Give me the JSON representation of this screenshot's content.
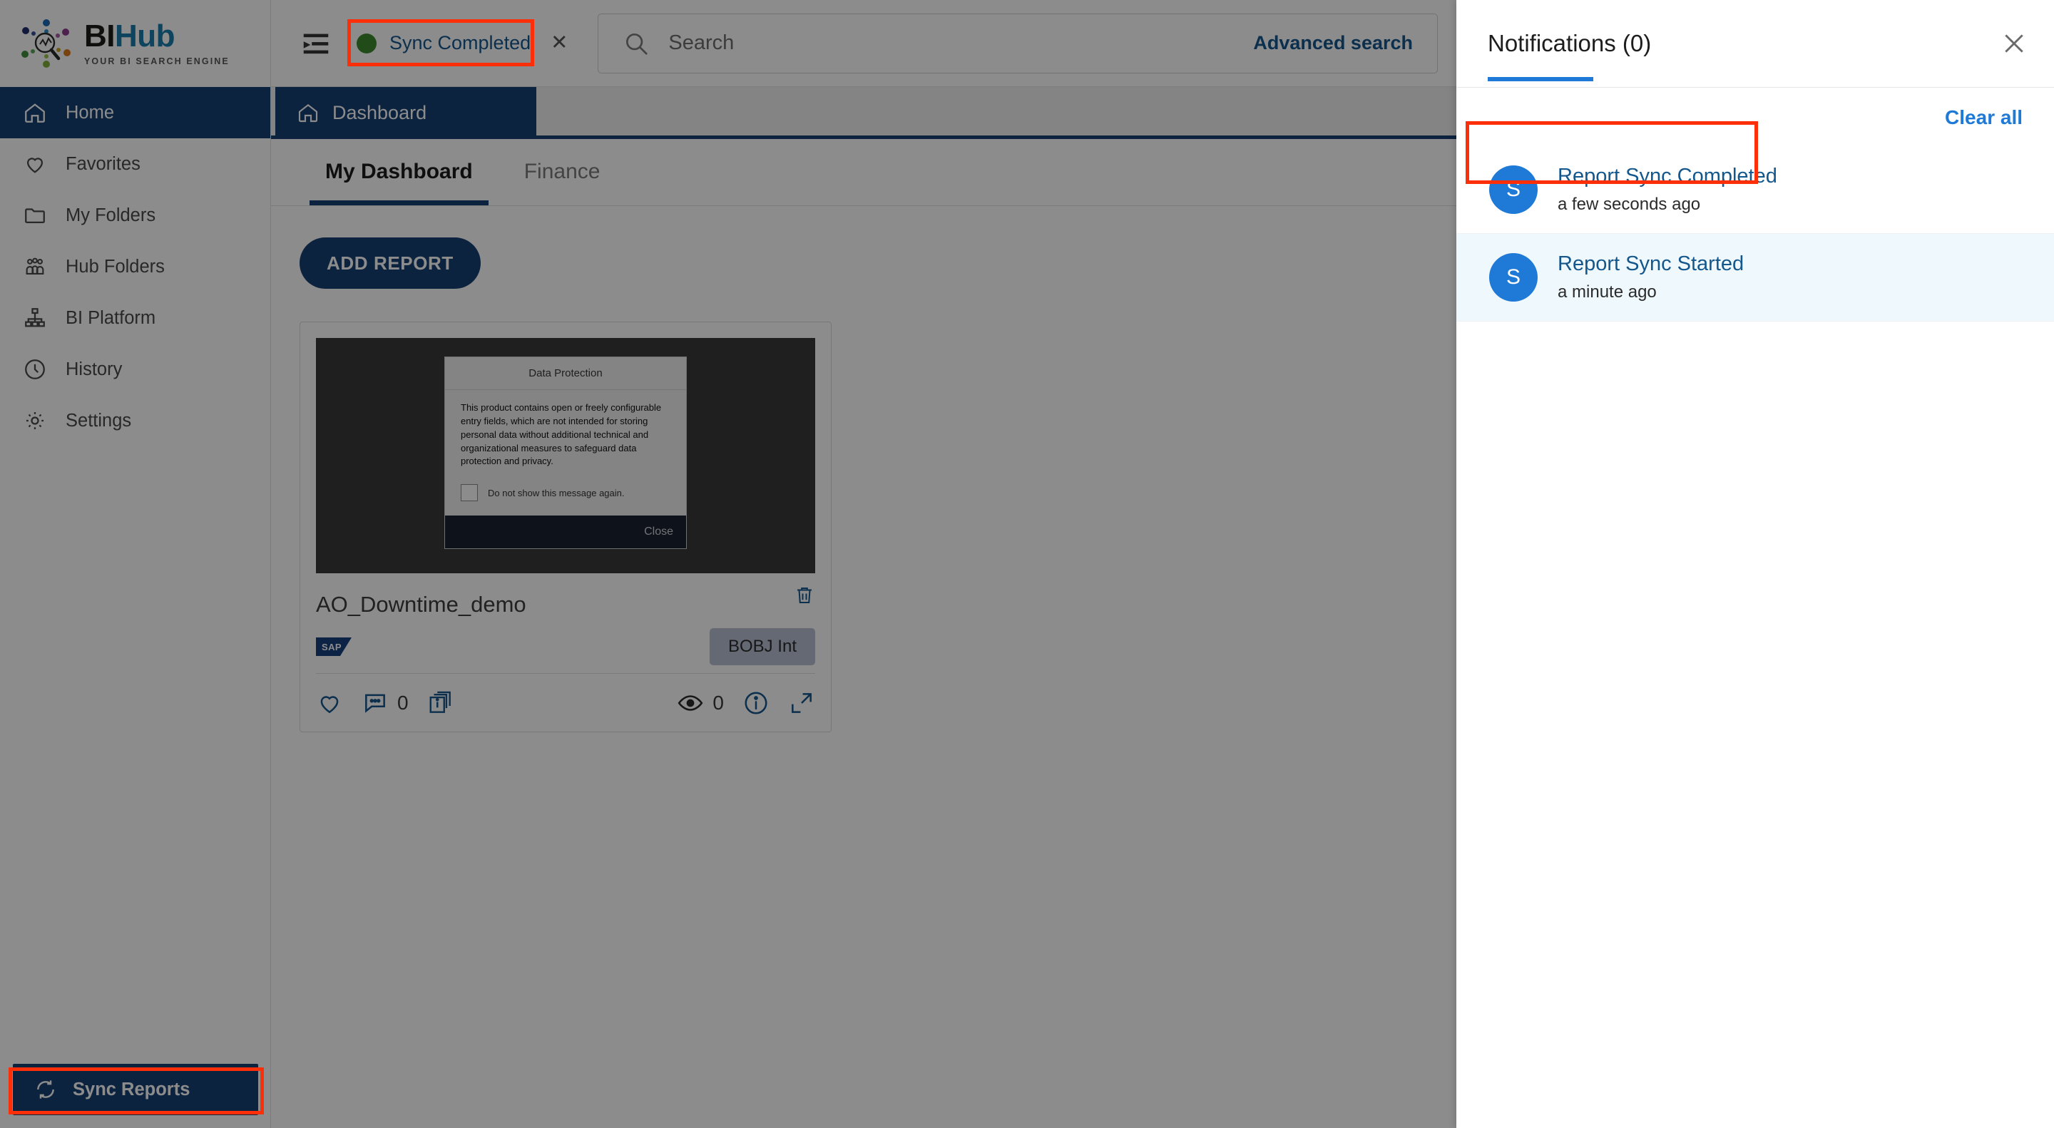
{
  "brand": {
    "title_bi": "BI",
    "title_hub": "Hub",
    "tagline": "YOUR BI SEARCH ENGINE",
    "accent_blue": "#174076",
    "logo_blue": "#1a7cab"
  },
  "sidebar": {
    "items": [
      {
        "label": "Home",
        "icon": "home-icon",
        "active": true
      },
      {
        "label": "Favorites",
        "icon": "heart-icon",
        "active": false
      },
      {
        "label": "My Folders",
        "icon": "folder-icon",
        "active": false
      },
      {
        "label": "Hub Folders",
        "icon": "people-icon",
        "active": false
      },
      {
        "label": "BI Platform",
        "icon": "sitemap-icon",
        "active": false
      },
      {
        "label": "History",
        "icon": "clock-icon",
        "active": false
      },
      {
        "label": "Settings",
        "icon": "gear-icon",
        "active": false
      }
    ],
    "sync_reports_label": "Sync Reports"
  },
  "topbar": {
    "filter_icon": "filter-list-icon",
    "chip": {
      "label": "Sync Completed",
      "dot_color": "#3d8b2e",
      "close_icon": "close-icon"
    },
    "search": {
      "placeholder": "Search",
      "value": "",
      "icon": "search-icon"
    },
    "advanced_search_label": "Advanced search"
  },
  "content": {
    "breadcrumb": {
      "label": "Dashboard",
      "icon": "home-icon"
    },
    "tabs": [
      {
        "label": "My Dashboard",
        "active": true
      },
      {
        "label": "Finance",
        "active": false
      }
    ],
    "add_report_label": "ADD REPORT",
    "card": {
      "title": "AO_Downtime_demo",
      "badge": "BOBJ Int",
      "source_logo": "SAP",
      "delete_icon": "trash-icon",
      "like_icon": "heart-icon",
      "comment_icon": "comment-icon",
      "comment_count": "0",
      "copies_icon": "stacked-info-icon",
      "views_icon": "eye-icon",
      "views_count": "0",
      "info_icon": "info-circle-icon",
      "expand_icon": "expand-icon",
      "thumbnail_dialog": {
        "title": "Data Protection",
        "body": "This product contains open or freely configurable entry fields, which are not intended for storing personal data without additional technical and organizational measures to safeguard data protection and privacy.",
        "checkbox_label": "Do not show this message again.",
        "close_label": "Close"
      }
    }
  },
  "notifications": {
    "title": "Notifications (0)",
    "close_icon": "close-icon",
    "clear_all_label": "Clear all",
    "items": [
      {
        "avatar": "S",
        "title": "Report Sync Completed",
        "time": "a few seconds ago",
        "unread": false
      },
      {
        "avatar": "S",
        "title": "Report Sync Started",
        "time": "a minute ago",
        "unread": true
      }
    ]
  },
  "annotations": {
    "color": "#fc2f09"
  }
}
